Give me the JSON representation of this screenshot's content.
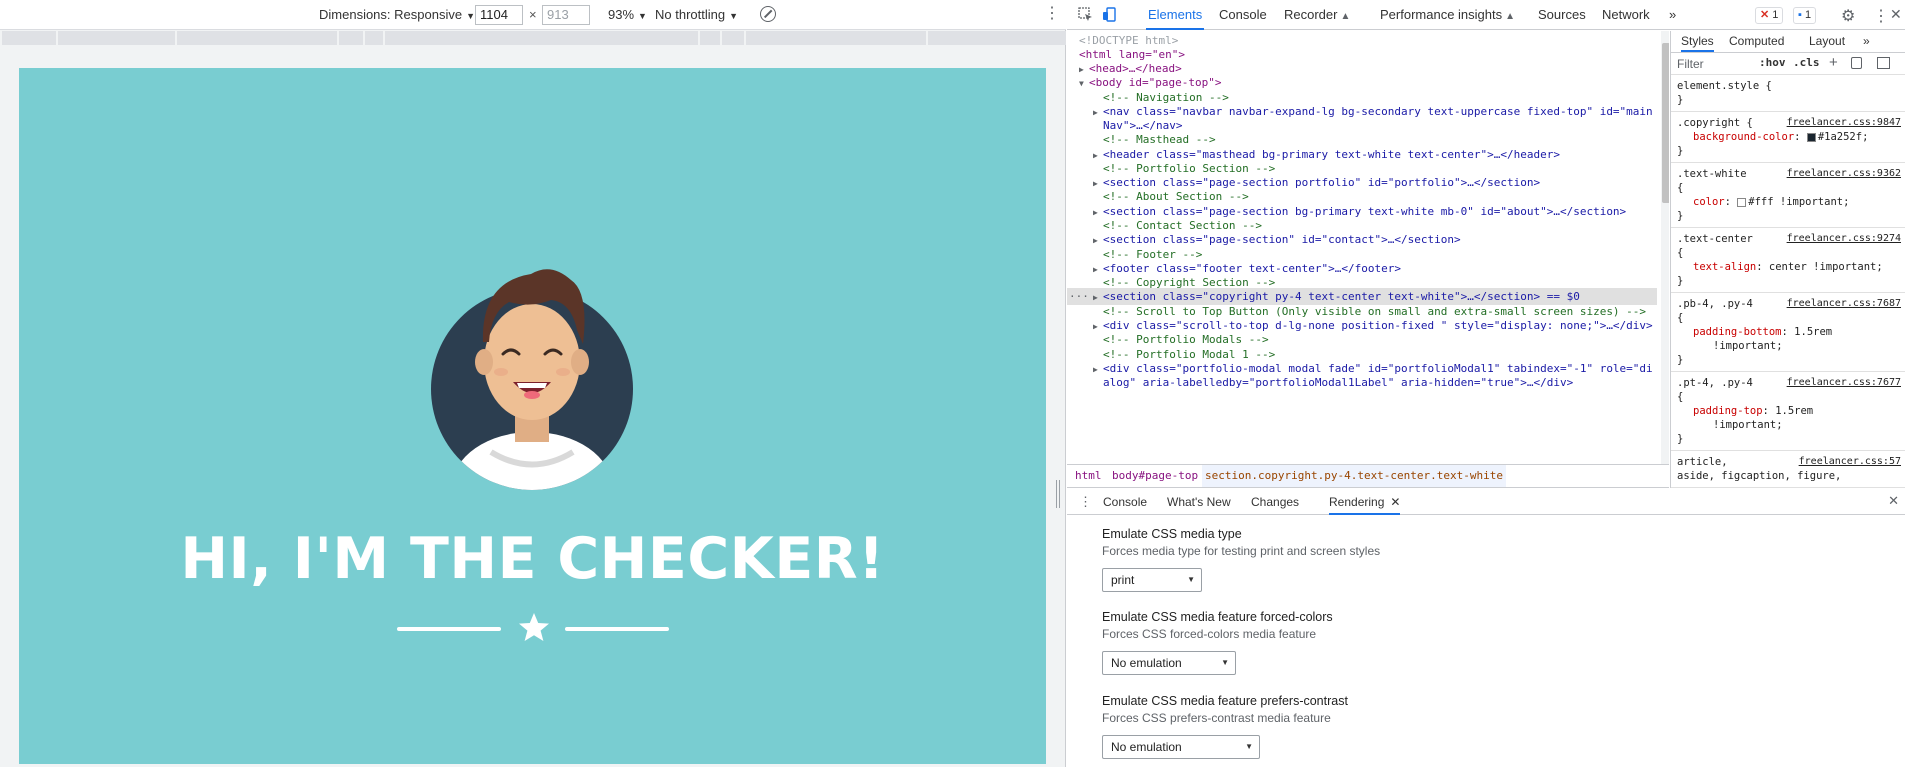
{
  "device_toolbar": {
    "dimensions_label": "Dimensions: Responsive",
    "width": "1104",
    "height": "913",
    "zoom": "93%",
    "throttling": "No throttling"
  },
  "page": {
    "hero_title": "HI, I'M THE CHECKER!"
  },
  "devtools": {
    "tabs": [
      "Elements",
      "Console",
      "Recorder",
      "Performance insights",
      "Sources",
      "Network"
    ],
    "more_tabs": "»",
    "error_count": "1",
    "message_count": "1",
    "dom": [
      {
        "text": "<!DOCTYPE html>"
      },
      {
        "text": "<html lang=\"en\">"
      },
      {
        "text": "<head>…</head>"
      },
      {
        "text": "<body id=\"page-top\">"
      },
      {
        "text": "<!-- Navigation -->"
      },
      {
        "text": "<nav class=\"navbar navbar-expand-lg bg-secondary text-uppercase fixed-top\" id=\"main"
      },
      {
        "text": "Nav\">…</nav>"
      },
      {
        "text": "<!-- Masthead -->"
      },
      {
        "text": "<header class=\"masthead bg-primary text-white text-center\">…</header>"
      },
      {
        "text": "<!-- Portfolio Section -->"
      },
      {
        "text": "<section class=\"page-section portfolio\" id=\"portfolio\">…</section>"
      },
      {
        "text": "<!-- About Section -->"
      },
      {
        "text": "<section class=\"page-section bg-primary text-white mb-0\" id=\"about\">…</section>"
      },
      {
        "text": "<!-- Contact Section -->"
      },
      {
        "text": "<section class=\"page-section\" id=\"contact\">…</section>"
      },
      {
        "text": "<!-- Footer -->"
      },
      {
        "text": "<footer class=\"footer text-center\">…</footer>"
      },
      {
        "text": "<!-- Copyright Section -->"
      },
      {
        "text": "<section class=\"copyright py-4 text-center text-white\">…</section> == $0"
      },
      {
        "text": "<!-- Scroll to Top Button (Only visible on small and extra-small screen sizes) -->"
      },
      {
        "text": "<div class=\"scroll-to-top d-lg-none position-fixed \" style=\"display: none;\">…</div>"
      },
      {
        "text": "<!-- Portfolio Modals -->"
      },
      {
        "text": "<!-- Portfolio Modal 1 -->"
      },
      {
        "text": "<div class=\"portfolio-modal modal fade\" id=\"portfolioModal1\" tabindex=\"-1\" role=\"di"
      },
      {
        "text": "alog\" aria-labelledby=\"portfolioModal1Label\" aria-hidden=\"true\">…</div>"
      }
    ],
    "breadcrumbs": [
      "html",
      "body#page-top",
      "section.copyright.py-4.text-center.text-white"
    ],
    "styles_tabs": [
      "Styles",
      "Computed",
      "Layout",
      "»"
    ],
    "filter_placeholder": "Filter",
    "hov": ":hov",
    "cls": ".cls",
    "rules": [
      {
        "selector": "element.style {",
        "source": "",
        "props": [],
        "close": "}"
      },
      {
        "selector": ".copyright {",
        "source": "freelancer.css:9847",
        "props": [
          {
            "name": "background-color",
            "value": "#1a252f;",
            "swatch": "#1a252f"
          }
        ],
        "close": "}"
      },
      {
        "selector": ".text-white",
        "source": "freelancer.css:9362",
        "open": "{",
        "props": [
          {
            "name": "color",
            "value": "#fff !important;",
            "swatch": "#ffffff"
          }
        ],
        "close": "}"
      },
      {
        "selector": ".text-center",
        "source": "freelancer.css:9274",
        "open": "{",
        "props": [
          {
            "name": "text-align",
            "value": "center !important;"
          }
        ],
        "close": "}"
      },
      {
        "selector": ".pb-4, .py-4",
        "source": "freelancer.css:7687",
        "open": "{",
        "props": [
          {
            "name": "padding-bottom",
            "value": "1.5rem"
          },
          {
            "name": "",
            "value": "!important;"
          }
        ],
        "close": "}"
      },
      {
        "selector": ".pt-4, .py-4",
        "source": "freelancer.css:7677",
        "open": "{",
        "props": [
          {
            "name": "padding-top",
            "value": "1.5rem"
          },
          {
            "name": "",
            "value": "!important;"
          }
        ],
        "close": "}"
      },
      {
        "selector": "article,",
        "source": "freelancer.css:57",
        "open": "aside, figcaption, figure,",
        "props": [],
        "close": ""
      }
    ],
    "drawer_tabs": [
      "Console",
      "What's New",
      "Changes",
      "Rendering"
    ],
    "rendering": [
      {
        "title": "Emulate CSS media type",
        "desc": "Forces media type for testing print and screen styles",
        "value": "print"
      },
      {
        "title": "Emulate CSS media feature forced-colors",
        "desc": "Forces CSS forced-colors media feature",
        "value": "No emulation"
      },
      {
        "title": "Emulate CSS media feature prefers-contrast",
        "desc": "Forces CSS prefers-contrast media feature",
        "value": "No emulation"
      }
    ]
  },
  "colors": {
    "viewport_bg": "#79cdd1",
    "accent": "#1a73e8",
    "avatar_circle": "#2c3e50"
  }
}
